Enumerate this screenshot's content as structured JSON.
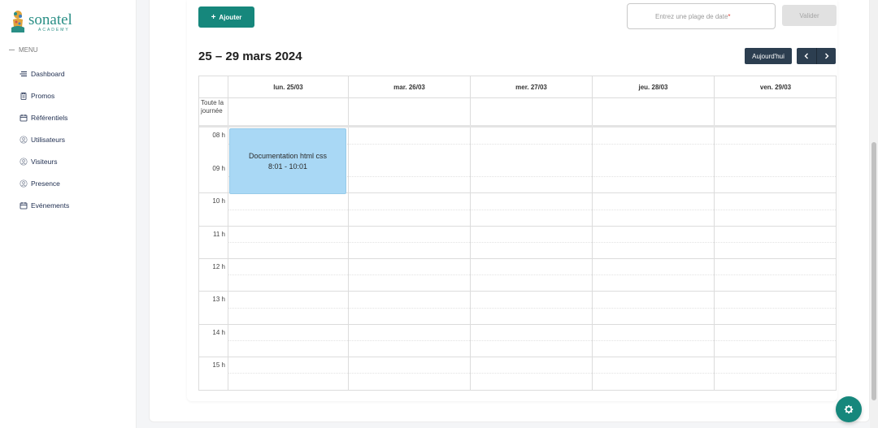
{
  "brand": {
    "name": "sonatel",
    "sub": "ACADEMY"
  },
  "sidebar": {
    "menu_label": "MENU",
    "items": [
      {
        "label": "Dashboard",
        "icon": "menu-lines-icon"
      },
      {
        "label": "Promos",
        "icon": "clipboard-icon"
      },
      {
        "label": "Référentiels",
        "icon": "calendar-icon"
      },
      {
        "label": "Utilisateurs",
        "icon": "user-circle-icon"
      },
      {
        "label": "Visiteurs",
        "icon": "user-circle-icon"
      },
      {
        "label": "Presence",
        "icon": "user-circle-icon"
      },
      {
        "label": "Evénements",
        "icon": "calendar-icon"
      }
    ]
  },
  "toolbar": {
    "add_label": "Ajouter",
    "date_range_placeholder": "Entrez une plage de date",
    "required_mark": "*",
    "validate_label": "Valider"
  },
  "calendar": {
    "title": "25 – 29 mars 2024",
    "today_label": "Aujourd'hui",
    "all_day_label": "Toute la journée",
    "days": [
      "lun. 25/03",
      "mar. 26/03",
      "mer. 27/03",
      "jeu. 28/03",
      "ven. 29/03"
    ],
    "hours": [
      "08 h",
      "09 h",
      "10 h",
      "11 h",
      "12 h",
      "13 h",
      "14 h",
      "15 h"
    ],
    "event": {
      "title": "Documentation html css",
      "time": "8:01 - 10:01",
      "color": "#a9d8f5"
    }
  },
  "colors": {
    "primary": "#16877c",
    "dark_nav": "#2c3e50"
  }
}
